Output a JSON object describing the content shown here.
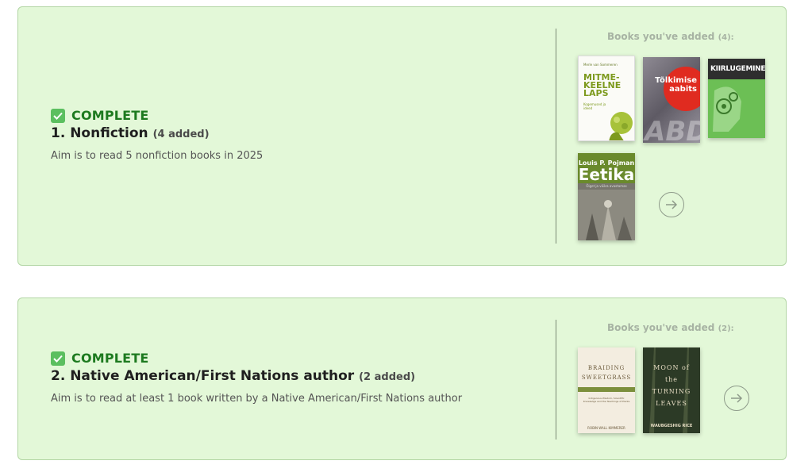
{
  "goals": [
    {
      "status": "COMPLETE",
      "title": "1. Nonfiction",
      "count_label": "(4 added)",
      "description": "Aim is to read 5 nonfiction books in 2025",
      "books_label": "Books you've added",
      "books_count": "(4):",
      "books": [
        {
          "author": "Merle van Sommeren",
          "title": "MITME-KEELNE LAPS",
          "subtitle": "Kogemused ja ideed"
        },
        {
          "title": "Tõlkimise aabits"
        },
        {
          "title": "KIIRLUGEMINE"
        },
        {
          "author": "Louis P. Pojman",
          "title": "Eetika",
          "subtitle": "Õiget ja väära avastamas"
        }
      ]
    },
    {
      "status": "COMPLETE",
      "title": "2. Native American/First Nations author",
      "count_label": "(2 added)",
      "description": "Aim is to read at least 1 book written by a Native American/First Nations author",
      "books_label": "Books you've added",
      "books_count": "(2):",
      "books": [
        {
          "title": "BRAIDING SWEETGRASS",
          "subtitle": "Indigenous Wisdom, Scientific Knowledge and the Teachings of Plants",
          "author": "ROBIN WALL KIMMERER"
        },
        {
          "title": "MOON of the TURNING LEAVES",
          "author": "WAUBGESHIG RICE"
        }
      ]
    }
  ],
  "icons": {
    "status": "checkbox-checked-icon",
    "next": "arrow-right-circle-icon"
  },
  "colors": {
    "card_bg": "#e3f8d8",
    "status_green": "#1d7a1f",
    "check_bg": "#5bbf5f"
  }
}
